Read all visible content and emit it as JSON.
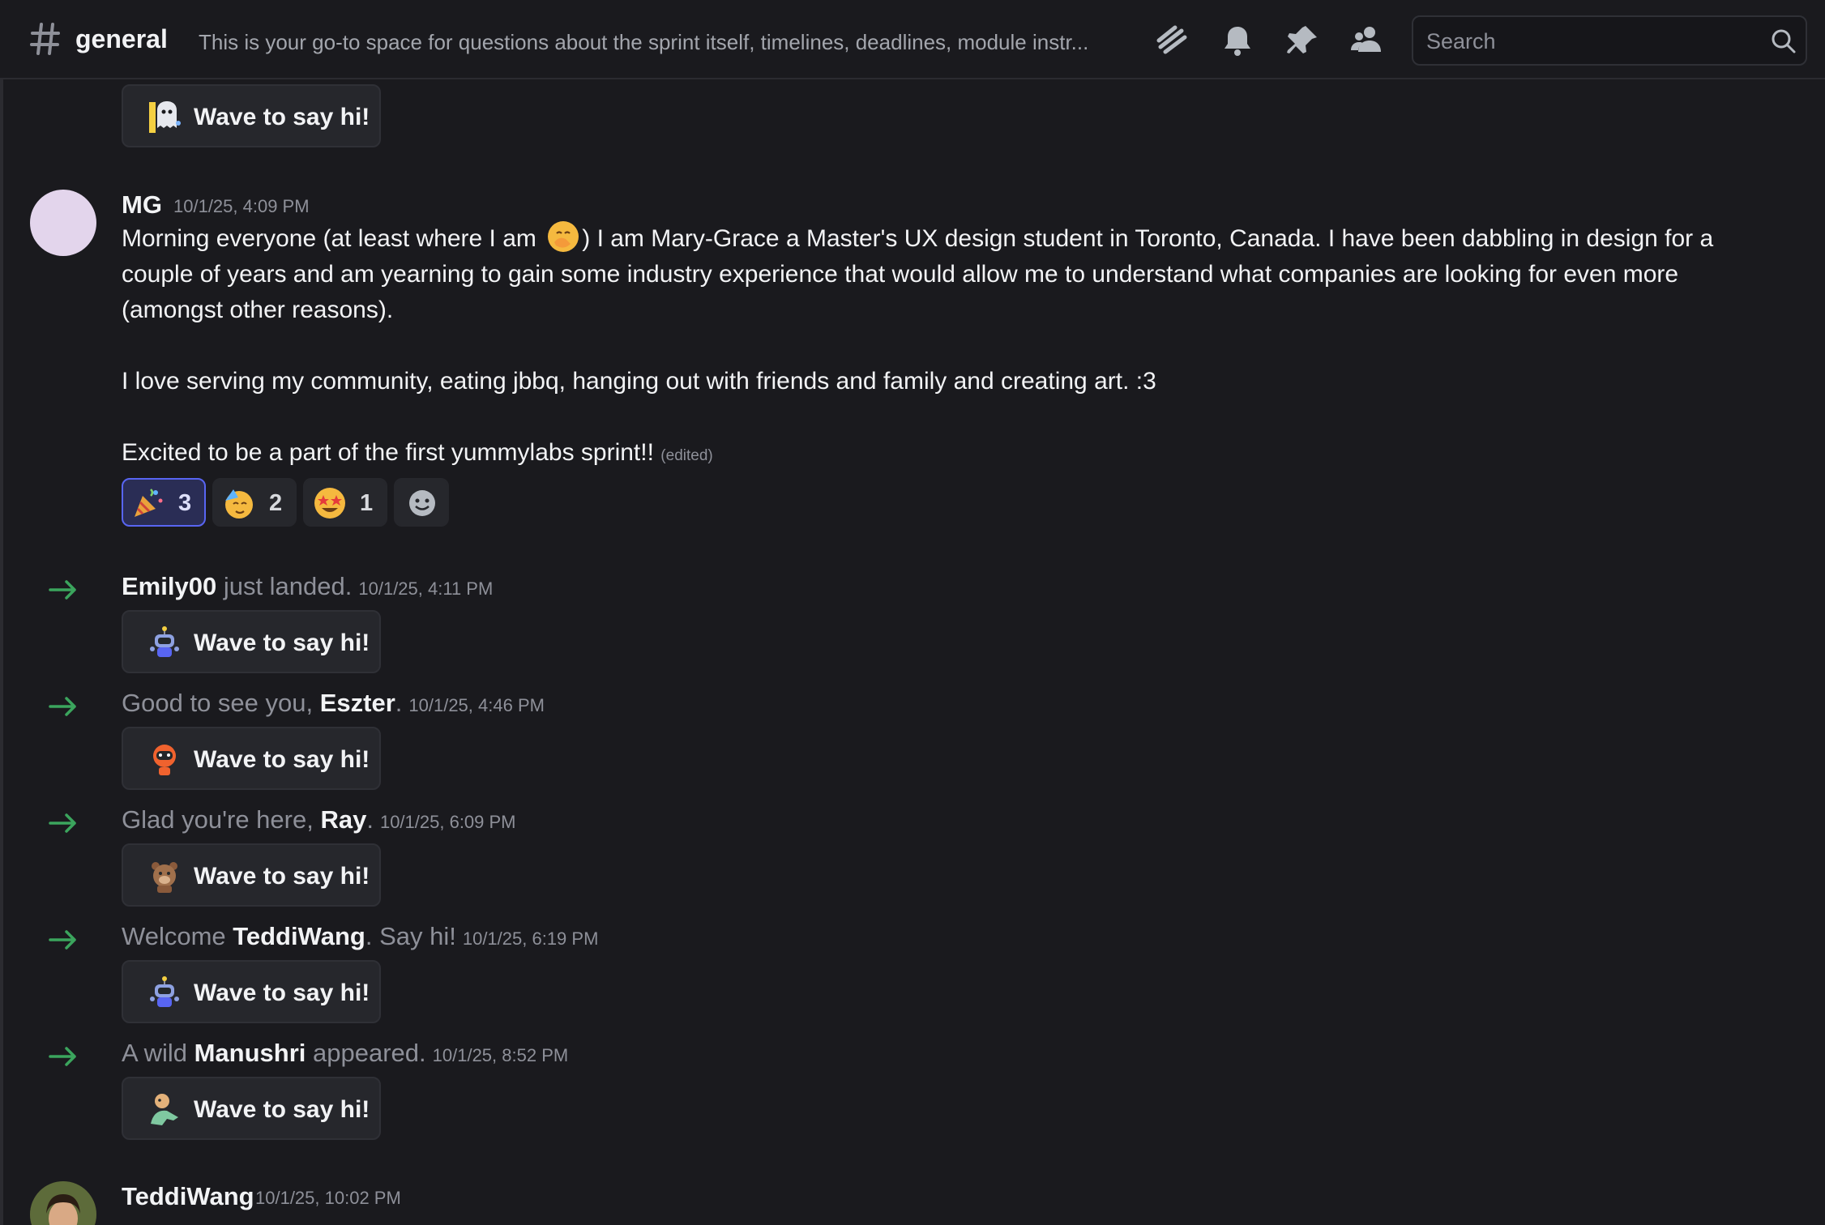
{
  "channel": {
    "name": "general",
    "topic": "This is your go-to space for questions about the sprint itself, timelines, deadlines, module instr..."
  },
  "search": {
    "placeholder": "Search"
  },
  "header_icons": [
    "threads-icon",
    "bell-icon",
    "pin-icon",
    "members-icon"
  ],
  "wave": {
    "label": "Wave to say hi!"
  },
  "messages": {
    "mg": {
      "author": "MG",
      "timestamp": "10/1/25, 4:09 PM",
      "line1a": "Morning everyone (at least where I am ",
      "line1b": ") I am Mary-Grace a Master's UX design student in Toronto, Canada. I have been dabbling in design for a",
      "line2": "couple of years and am yearning to gain some industry experience that would allow me to understand what companies are looking for even more",
      "line3": "(amongst other reasons).",
      "line4": "I love serving my community, eating jbbq, hanging out with friends and family and creating art. :3",
      "line5": "Excited to be a part of the first yummylabs sprint!!",
      "edited": "(edited)",
      "reactions": [
        {
          "emoji": "party-popper",
          "count": "3",
          "active": true
        },
        {
          "emoji": "partying-face",
          "count": "2",
          "active": false
        },
        {
          "emoji": "star-struck",
          "count": "1",
          "active": false
        }
      ]
    },
    "teddi": {
      "author": "TeddiWang",
      "timestamp": "10/1/25, 10:02 PM"
    }
  },
  "joins": [
    {
      "pre": "",
      "name": "Emily00",
      "post": " just landed.",
      "timestamp": "10/1/25, 4:11 PM"
    },
    {
      "pre": "Good to see you, ",
      "name": "Eszter",
      "post": ".",
      "timestamp": "10/1/25, 4:46 PM"
    },
    {
      "pre": "Glad you're here, ",
      "name": "Ray",
      "post": ".",
      "timestamp": "10/1/25, 6:09 PM"
    },
    {
      "pre": "Welcome ",
      "name": "TeddiWang",
      "post": ". Say hi!",
      "timestamp": "10/1/25, 6:19 PM"
    },
    {
      "pre": "A wild ",
      "name": "Manushri",
      "post": " appeared.",
      "timestamp": "10/1/25, 8:52 PM"
    }
  ],
  "colors": {
    "background": "#1a1a1e",
    "join_arrow": "#3ba55d",
    "reaction_active": "#5865f2",
    "mg_avatar": "#e3d5ec"
  }
}
